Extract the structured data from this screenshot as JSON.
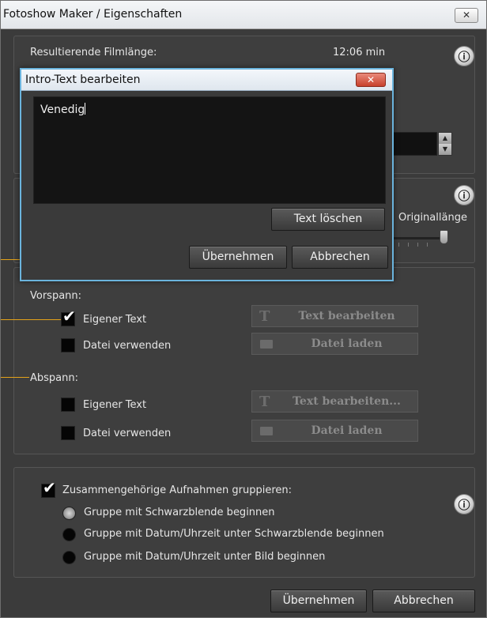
{
  "window": {
    "title": "Fotoshow Maker / Eigenschaften",
    "close_label": "✕"
  },
  "film": {
    "label": "Resultierende Filmlänge:",
    "value": "12:06 min"
  },
  "slider": {
    "label": "Originallänge"
  },
  "dialog": {
    "title": "Intro-Text bearbeiten",
    "close_label": "✕",
    "text_value": "Venedig",
    "clear_label": "Text löschen",
    "ok_label": "Übernehmen",
    "cancel_label": "Abbrechen"
  },
  "vorspann": {
    "heading": "Vorspann:",
    "own_text": {
      "label": "Eigener Text",
      "checked": true
    },
    "use_file": {
      "label": "Datei verwenden",
      "checked": false
    },
    "edit_button": "Text bearbeiten",
    "load_button": "Datei laden"
  },
  "abspann": {
    "heading": "Abspann:",
    "own_text": {
      "label": "Eigener Text",
      "checked": false
    },
    "use_file": {
      "label": "Datei verwenden",
      "checked": false
    },
    "edit_button": "Text bearbeiten...",
    "load_button": "Datei laden"
  },
  "grouping": {
    "label": "Zusammengehörige Aufnahmen gruppieren:",
    "checked": true,
    "options": [
      {
        "label": "Gruppe mit Schwarzblende beginnen",
        "selected": true
      },
      {
        "label": "Gruppe mit Datum/Uhrzeit unter Schwarzblende beginnen",
        "selected": false
      },
      {
        "label": "Gruppe mit Datum/Uhrzeit unter Bild beginnen",
        "selected": false
      }
    ]
  },
  "footer": {
    "ok_label": "Übernehmen",
    "cancel_label": "Abbrechen"
  },
  "icons": {
    "info": "info-icon",
    "text": "text-t-icon",
    "folder": "folder-icon",
    "check": "checkmark-icon"
  },
  "colors": {
    "accent_dialog_border": "#6bb4dd",
    "callout_line": "#e3a21a",
    "close_red": "#c8412c"
  }
}
